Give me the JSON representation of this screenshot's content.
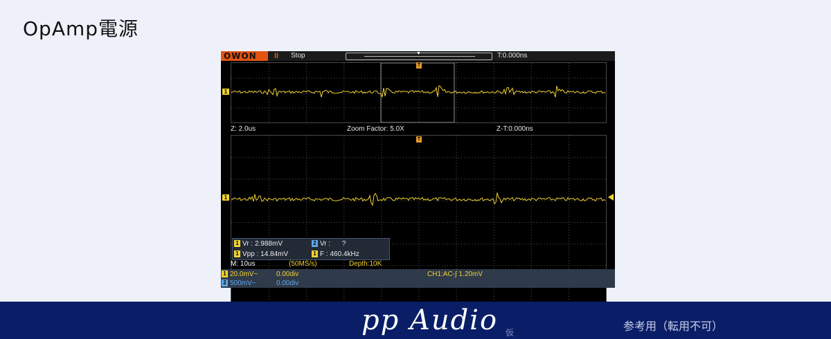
{
  "page": {
    "title": "OpAmp電源"
  },
  "scope": {
    "brand": "OWON",
    "run_icon": "II",
    "status": "Stop",
    "trigger_time": "T:0.000ns",
    "zoom_timebase": "Z: 2.0us",
    "zoom_factor": "Zoom Factor: 5.0X",
    "zoom_trigger_time": "Z-T:0.000ns",
    "trigger_marker": "T",
    "ch1_marker": "1",
    "measurements": {
      "ch1_vr": "Vr : 2.988mV",
      "ch2_vr": "Vr :      ?",
      "ch1_vpp": "Vpp : 14.84mV",
      "ch1_freq": "F : 460.4kHz",
      "tag1": "1",
      "tag2": "2"
    },
    "main_timebase": "M: 10us",
    "sample_rate": "(50MS/s)",
    "depth": "Depth:10K",
    "ch1_scale": "20.0mV~",
    "ch1_offset": "0.00div",
    "ch2_scale": "500mV~",
    "ch2_offset": "0.00div",
    "trigger_info": "CH1:AC-∫  1.20mV",
    "colors": {
      "ch1": "#f2d230",
      "ch2": "#5fa8e8",
      "brand": "#e25312"
    }
  },
  "footer": {
    "logo": "pp Audio",
    "tentative": "仮",
    "note": "参考用（転用不可）"
  }
}
